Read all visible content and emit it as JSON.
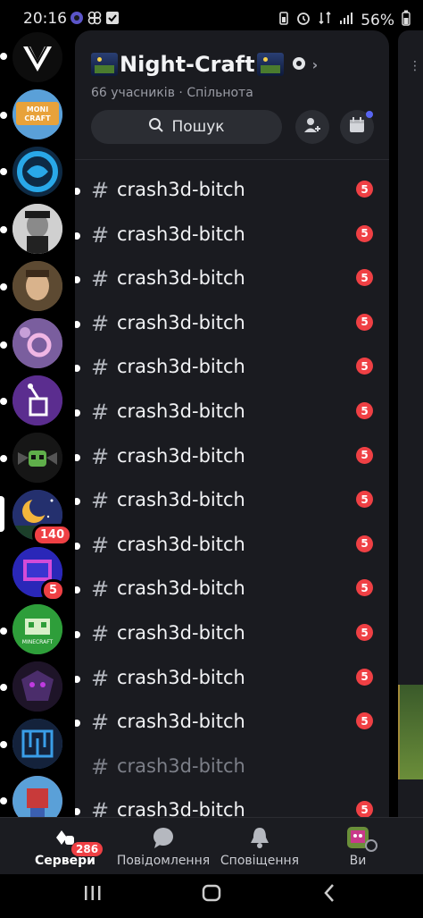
{
  "status_bar": {
    "time": "20:16",
    "battery": "56%"
  },
  "servers": [
    {
      "name": "vector-server",
      "color": "#111"
    },
    {
      "name": "moni-craft",
      "color": "#e8a23a",
      "label": "MONI CRAFT"
    },
    {
      "name": "swirl-server",
      "color": "#1b8fc9"
    },
    {
      "name": "man-portrait",
      "color": "#c9c9c9"
    },
    {
      "name": "boy-portrait",
      "color": "#6d5a3c"
    },
    {
      "name": "pink-ring",
      "color": "#8e6aa8"
    },
    {
      "name": "purple-sign",
      "color": "#5b2d8f"
    },
    {
      "name": "skull-dark",
      "color": "#1d1d1d"
    },
    {
      "name": "moon-night",
      "color": "#2d3b8f",
      "badge": "140"
    },
    {
      "name": "neon-server",
      "color": "#3a35d0",
      "badge": "5"
    },
    {
      "name": "green-minecraft",
      "color": "#2e9e3a",
      "label": "MINECRAFT"
    },
    {
      "name": "dark-dragon",
      "color": "#2d1f3d"
    },
    {
      "name": "blue-maze",
      "color": "#2a6cc0"
    },
    {
      "name": "red-character",
      "color": "#b03030"
    }
  ],
  "server_header": {
    "title": "Night-Craft",
    "members": "66 учасників",
    "separator": "·",
    "community": "Спільнота",
    "search_label": "Пошук"
  },
  "channels": [
    {
      "name": "crash3d-bitch",
      "badge": "5",
      "dim": false
    },
    {
      "name": "crash3d-bitch",
      "badge": "5",
      "dim": false
    },
    {
      "name": "crash3d-bitch",
      "badge": "5",
      "dim": false
    },
    {
      "name": "crash3d-bitch",
      "badge": "5",
      "dim": false
    },
    {
      "name": "crash3d-bitch",
      "badge": "5",
      "dim": false
    },
    {
      "name": "crash3d-bitch",
      "badge": "5",
      "dim": false
    },
    {
      "name": "crash3d-bitch",
      "badge": "5",
      "dim": false
    },
    {
      "name": "crash3d-bitch",
      "badge": "5",
      "dim": false
    },
    {
      "name": "crash3d-bitch",
      "badge": "5",
      "dim": false
    },
    {
      "name": "crash3d-bitch",
      "badge": "5",
      "dim": false
    },
    {
      "name": "crash3d-bitch",
      "badge": "5",
      "dim": false
    },
    {
      "name": "crash3d-bitch",
      "badge": "5",
      "dim": false
    },
    {
      "name": "crash3d-bitch",
      "badge": "5",
      "dim": false
    },
    {
      "name": "crash3d-bitch",
      "badge": "",
      "dim": true
    },
    {
      "name": "crash3d-bitch",
      "badge": "5",
      "dim": false
    }
  ],
  "bottom_nav": {
    "servers": "Сервери",
    "servers_badge": "286",
    "messages": "Повідомлення",
    "notifications": "Сповіщення",
    "you": "Ви"
  },
  "colors": {
    "accent": "#5865f2",
    "badge": "#ef4044",
    "panel": "#1a1b20"
  }
}
